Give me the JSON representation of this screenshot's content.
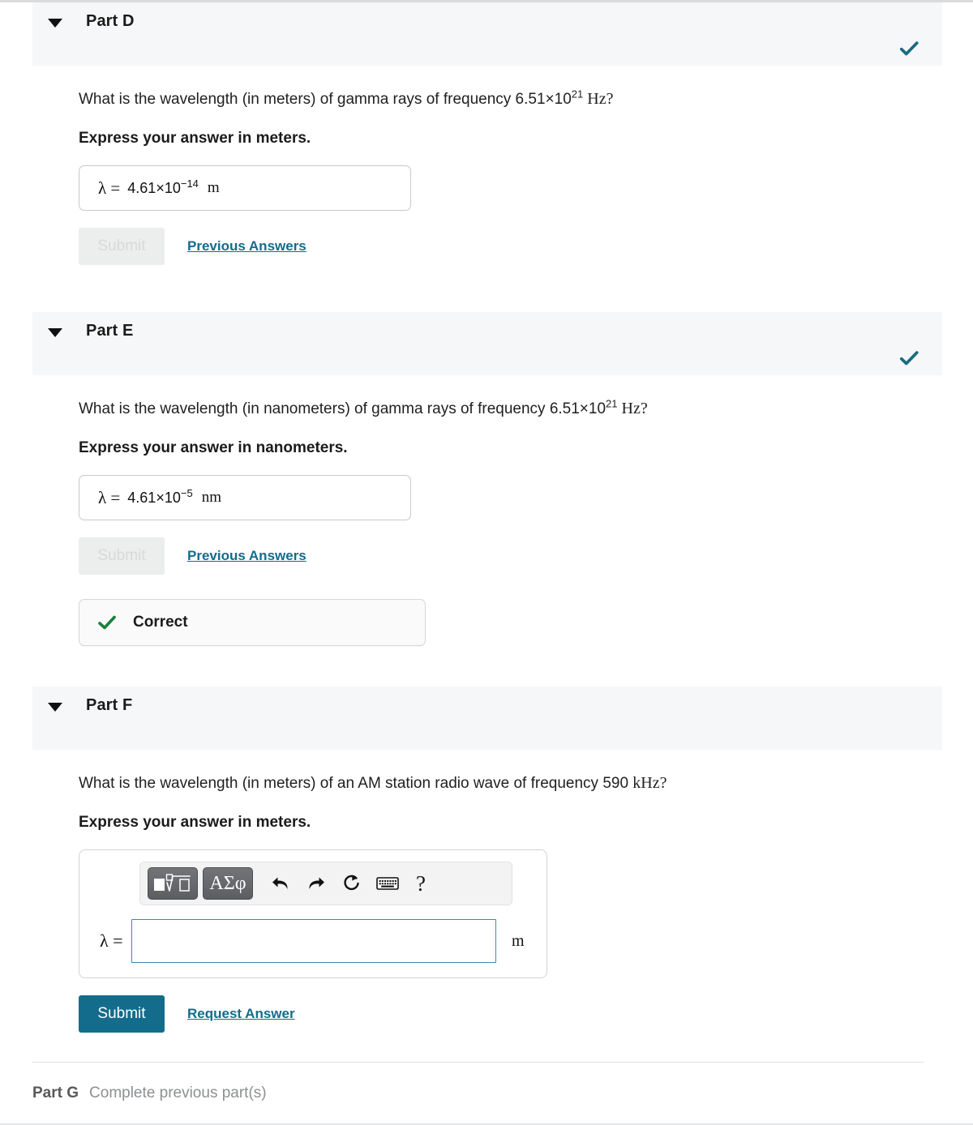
{
  "parts": [
    {
      "id": "part-d",
      "title": "Part D",
      "status_icon": "check-icon",
      "question_pre": "What is the wavelength (in meters) of gamma rays of frequency 6.51×10",
      "question_exp": "21",
      "question_unit": "Hz?",
      "instruction": "Express your answer in meters.",
      "answer": {
        "symbol": "λ =",
        "mantissa": "4.61×10",
        "exponent": "−14",
        "unit": "m"
      },
      "submit_label": "Submit",
      "submit_enabled": false,
      "link_label": "Previous Answers",
      "feedback": null
    },
    {
      "id": "part-e",
      "title": "Part E",
      "status_icon": "check-icon",
      "question_pre": "What is the wavelength (in nanometers) of gamma rays of frequency 6.51×10",
      "question_exp": "21",
      "question_unit": "Hz?",
      "instruction": "Express your answer in nanometers.",
      "answer": {
        "symbol": "λ =",
        "mantissa": "4.61×10",
        "exponent": "−5",
        "unit": "nm"
      },
      "submit_label": "Submit",
      "submit_enabled": false,
      "link_label": "Previous Answers",
      "feedback": {
        "icon": "check-icon",
        "text": "Correct",
        "color": "#17813c"
      }
    }
  ],
  "part_f": {
    "id": "part-f",
    "title": "Part F",
    "status_icon": null,
    "question_pre": "What is the wavelength (in meters) of an AM station radio wave of frequency 590 ",
    "question_unit": "kHz?",
    "instruction": "Express your answer in meters.",
    "toolbar": {
      "sqrt_button": "square-root-template-button",
      "greek_button": "ΑΣφ",
      "undo_icon": "undo-arrow-icon",
      "redo_icon": "redo-arrow-icon",
      "reset_icon": "reset-circular-arrow-icon",
      "keyboard_icon": "keyboard-icon",
      "help_label": "?"
    },
    "input": {
      "symbol": "λ =",
      "value": "",
      "placeholder": "",
      "unit": "m"
    },
    "submit_label": "Submit",
    "submit_enabled": true,
    "link_label": "Request Answer"
  },
  "part_g": {
    "label": "Part G",
    "note": "Complete previous part(s)"
  },
  "colors": {
    "accent_teal": "#136c8c",
    "status_check": "#1a6b80",
    "correct_green": "#17813c",
    "header_band": "#f6f7f8",
    "input_border": "#3b8ba8"
  }
}
